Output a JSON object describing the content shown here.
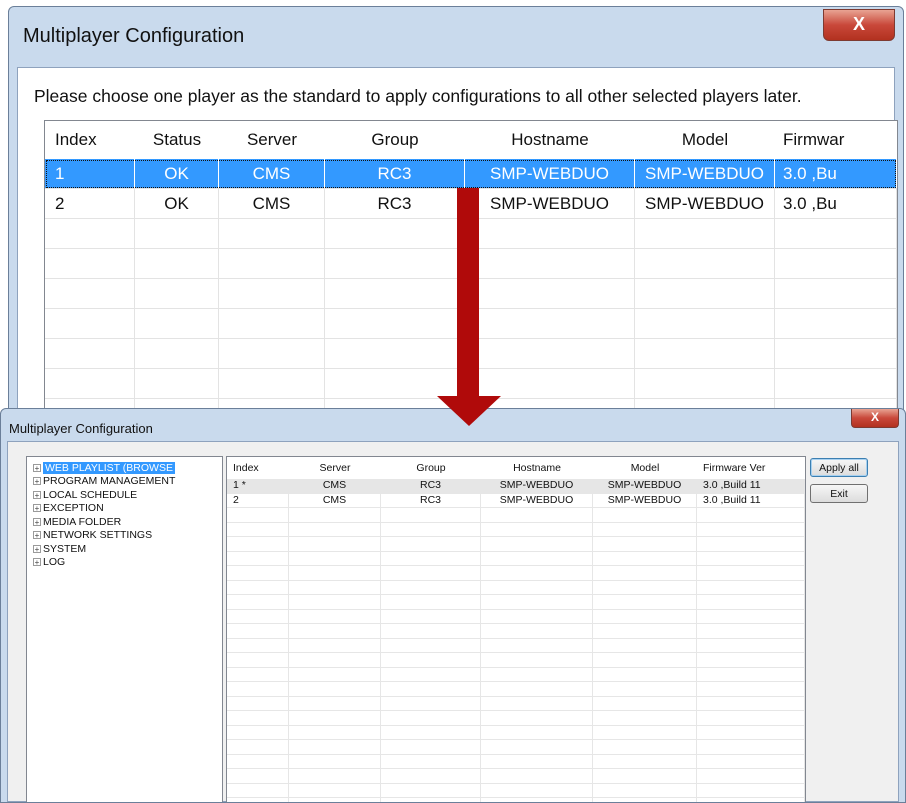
{
  "zoomed_dialog": {
    "title": "Multiplayer Configuration",
    "close_glyph": "X",
    "instruction": "Please choose one player as the standard to apply configurations to all other selected players later.",
    "columns": [
      "Index",
      "Status",
      "Server",
      "Group",
      "Hostname",
      "Model",
      "Firmwar"
    ],
    "rows": [
      [
        "1",
        "OK",
        "CMS",
        "RC3",
        "SMP-WEBDUO",
        "SMP-WEBDUO",
        "3.0 ,Bu"
      ],
      [
        "2",
        "OK",
        "CMS",
        "RC3",
        "SMP-WEBDUO",
        "SMP-WEBDUO",
        "3.0 ,Bu"
      ]
    ],
    "selected_row": 0
  },
  "arrow": {
    "color": "#b00a0a"
  },
  "full_dialog": {
    "title": "Multiplayer Configuration",
    "close_glyph": "X",
    "tree": [
      "WEB PLAYLIST (BROWSE",
      "PROGRAM MANAGEMENT",
      "LOCAL SCHEDULE",
      "EXCEPTION",
      "MEDIA FOLDER",
      "NETWORK SETTINGS",
      "SYSTEM",
      "LOG"
    ],
    "selected_tree_item": 0,
    "columns": [
      "Index",
      "Server",
      "Group",
      "Hostname",
      "Model",
      "Firmware Ver"
    ],
    "rows": [
      [
        "1 *",
        "CMS",
        "RC3",
        "SMP-WEBDUO",
        "SMP-WEBDUO",
        "3.0 ,Build 11"
      ],
      [
        "2",
        "CMS",
        "RC3",
        "SMP-WEBDUO",
        "SMP-WEBDUO",
        "3.0 ,Build 11"
      ]
    ],
    "apply_all_label": "Apply all",
    "exit_label": "Exit"
  },
  "colors": {
    "selection": "#3399ff",
    "window_frame": "#c9daed",
    "close_button": "#c9483a"
  }
}
